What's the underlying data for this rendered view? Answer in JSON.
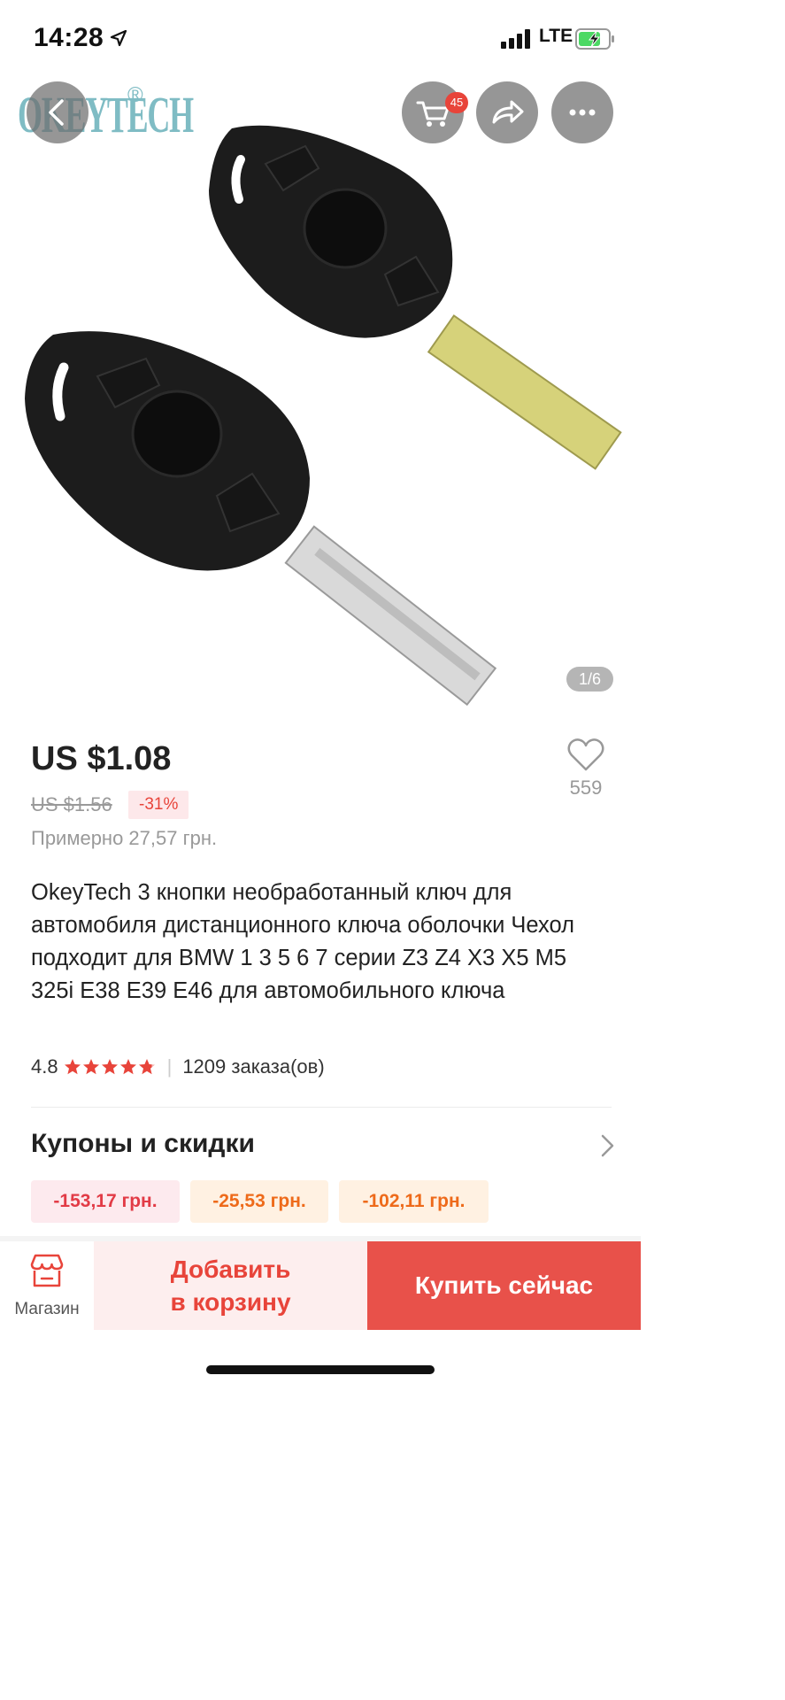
{
  "status_bar": {
    "time": "14:28",
    "network": "LTE",
    "location_icon": "location-arrow-icon",
    "signal_icon": "signal-bars-icon",
    "battery_icon": "battery-charging-icon"
  },
  "gallery": {
    "brand_logo": "OKEYTECH",
    "brand_reg": "®",
    "cart_count": "45",
    "pager": "1/6",
    "back_icon": "chevron-left-icon",
    "cart_icon": "shopping-cart-icon",
    "share_icon": "share-arrow-icon",
    "more_icon": "more-dots-icon"
  },
  "product": {
    "price": "US $1.08",
    "old_price": "US $1.56",
    "discount": "-31%",
    "approx_price": "Примерно 27,57 грн.",
    "likes": "559",
    "title": "OkeyTech 3 кнопки необработанный ключ для автомобиля дистанционного ключа оболочки Чехол подходит для BMW 1 3 5 6 7 серии Z3 Z4 X3 X5 M5 325i E38 E39 E46 для автомобильного ключа",
    "rating": "4.8",
    "rating_stars": 4.8,
    "orders": "1209 заказа(ов)"
  },
  "coupons": {
    "title": "Купоны и скидки",
    "items": [
      "-153,17 грн.",
      "-25,53 грн.",
      "-102,11 грн."
    ]
  },
  "bottom_bar": {
    "store_label": "Магазин",
    "add_to_cart": "Добавить\nв корзину",
    "buy_now": "Купить сейчас"
  },
  "colors": {
    "accent": "#e8443a",
    "buy_button": "#e8514a",
    "add_cart_bg": "#fdeeee",
    "logo": "#7fbcc4"
  }
}
